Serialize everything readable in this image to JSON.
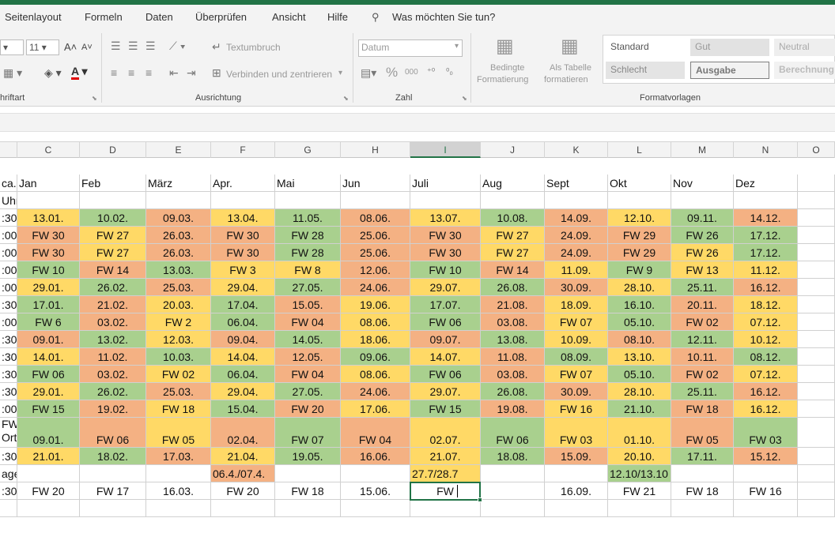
{
  "menu": [
    "Seitenlayout",
    "Formeln",
    "Daten",
    "Überprüfen",
    "Ansicht",
    "Hilfe"
  ],
  "tell_me": "Was möchten Sie tun?",
  "ribbon": {
    "font_size": "11",
    "wrap_text": "Textumbruch",
    "merge_center": "Verbinden und zentrieren",
    "number_format": "Datum",
    "percent": "%",
    "thousands": "000",
    "cond_format_1": "Bedingte",
    "cond_format_2": "Formatierung",
    "as_table_1": "Als Tabelle",
    "as_table_2": "formatieren",
    "groups": {
      "font": "hriftart",
      "alignment": "Ausrichtung",
      "number": "Zahl",
      "styles": "Formatvorlagen"
    },
    "styles": {
      "standard": "Standard",
      "gut": "Gut",
      "neutral": "Neutral",
      "schlecht": "Schlecht",
      "ausgabe": "Ausgabe",
      "berechnung": "Berechnung"
    }
  },
  "colors": {
    "green": "#a9d08e",
    "yellow": "#ffd966",
    "orange": "#f4b183",
    "excel_green": "#217346"
  },
  "col_headers": [
    "C",
    "D",
    "E",
    "F",
    "G",
    "H",
    "I",
    "J",
    "K",
    "L",
    "M",
    "N",
    "O"
  ],
  "selected_column": "I",
  "header_row_a": "ca.",
  "header_row_b": "Uhr",
  "months": [
    "Jan",
    "Feb",
    "März",
    "Apr.",
    "Mai",
    "Jun",
    "Juli",
    "Aug",
    "Sept",
    "Okt",
    "Nov",
    "Dez"
  ],
  "rows": [
    {
      "a": ":30",
      "v": [
        [
          "13.01.",
          "y"
        ],
        [
          "10.02.",
          "g"
        ],
        [
          "09.03.",
          "o"
        ],
        [
          "13.04.",
          "y"
        ],
        [
          "11.05.",
          "g"
        ],
        [
          "08.06.",
          "o"
        ],
        [
          "13.07.",
          "y"
        ],
        [
          "10.08.",
          "g"
        ],
        [
          "14.09.",
          "o"
        ],
        [
          "12.10.",
          "y"
        ],
        [
          "09.11.",
          "g"
        ],
        [
          "14.12.",
          "o"
        ]
      ]
    },
    {
      "a": ":00",
      "v": [
        [
          "FW 30",
          "o"
        ],
        [
          "FW 27",
          "y"
        ],
        [
          "26.03.",
          "o"
        ],
        [
          "FW 30",
          "o"
        ],
        [
          "FW 28",
          "g"
        ],
        [
          "25.06.",
          "o"
        ],
        [
          "FW 30",
          "o"
        ],
        [
          "FW 27",
          "y"
        ],
        [
          "24.09.",
          "o"
        ],
        [
          "FW 29",
          "o"
        ],
        [
          "FW 26",
          "g"
        ],
        [
          "17.12.",
          "g"
        ]
      ]
    },
    {
      "a": ":00",
      "v": [
        [
          "FW 30",
          "o"
        ],
        [
          "FW 27",
          "y"
        ],
        [
          "26.03.",
          "o"
        ],
        [
          "FW 30",
          "o"
        ],
        [
          "FW 28",
          "g"
        ],
        [
          "25.06.",
          "o"
        ],
        [
          "FW 30",
          "o"
        ],
        [
          "FW 27",
          "y"
        ],
        [
          "24.09.",
          "o"
        ],
        [
          "FW 29",
          "o"
        ],
        [
          "FW 26",
          "y"
        ],
        [
          "17.12.",
          "g"
        ]
      ]
    },
    {
      "a": ":00",
      "v": [
        [
          "FW 10",
          "g"
        ],
        [
          "FW 14",
          "o"
        ],
        [
          "13.03.",
          "g"
        ],
        [
          "FW 3",
          "y"
        ],
        [
          "FW 8",
          "y"
        ],
        [
          "12.06.",
          "o"
        ],
        [
          "FW 10",
          "g"
        ],
        [
          "FW 14",
          "o"
        ],
        [
          "11.09.",
          "y"
        ],
        [
          "FW 9",
          "g"
        ],
        [
          "FW 13",
          "y"
        ],
        [
          "11.12.",
          "y"
        ]
      ]
    },
    {
      "a": ":00",
      "v": [
        [
          "29.01.",
          "y"
        ],
        [
          "26.02.",
          "g"
        ],
        [
          "25.03.",
          "o"
        ],
        [
          "29.04.",
          "y"
        ],
        [
          "27.05.",
          "g"
        ],
        [
          "24.06.",
          "o"
        ],
        [
          "29.07.",
          "y"
        ],
        [
          "26.08.",
          "g"
        ],
        [
          "30.09.",
          "o"
        ],
        [
          "28.10.",
          "y"
        ],
        [
          "25.11.",
          "g"
        ],
        [
          "16.12.",
          "o"
        ]
      ]
    },
    {
      "a": ":30",
      "v": [
        [
          "17.01.",
          "g"
        ],
        [
          "21.02.",
          "o"
        ],
        [
          "20.03.",
          "y"
        ],
        [
          "17.04.",
          "g"
        ],
        [
          "15.05.",
          "o"
        ],
        [
          "19.06.",
          "y"
        ],
        [
          "17.07.",
          "g"
        ],
        [
          "21.08.",
          "o"
        ],
        [
          "18.09.",
          "y"
        ],
        [
          "16.10.",
          "g"
        ],
        [
          "20.11.",
          "o"
        ],
        [
          "18.12.",
          "y"
        ]
      ]
    },
    {
      "a": ":00",
      "v": [
        [
          "FW 6",
          "g"
        ],
        [
          "03.02.",
          "o"
        ],
        [
          "FW 2",
          "y"
        ],
        [
          "06.04.",
          "g"
        ],
        [
          "FW 04",
          "o"
        ],
        [
          "08.06.",
          "y"
        ],
        [
          "FW 06",
          "g"
        ],
        [
          "03.08.",
          "o"
        ],
        [
          "FW 07",
          "y"
        ],
        [
          "05.10.",
          "g"
        ],
        [
          "FW 02",
          "o"
        ],
        [
          "07.12.",
          "y"
        ]
      ]
    },
    {
      "a": ":30",
      "v": [
        [
          "09.01.",
          "o"
        ],
        [
          "13.02.",
          "g"
        ],
        [
          "12.03.",
          "y"
        ],
        [
          "09.04.",
          "o"
        ],
        [
          "14.05.",
          "g"
        ],
        [
          "18.06.",
          "y"
        ],
        [
          "09.07.",
          "o"
        ],
        [
          "13.08.",
          "g"
        ],
        [
          "10.09.",
          "y"
        ],
        [
          "08.10.",
          "o"
        ],
        [
          "12.11.",
          "g"
        ],
        [
          "10.12.",
          "y"
        ]
      ]
    },
    {
      "a": ":30",
      "v": [
        [
          "14.01.",
          "y"
        ],
        [
          "11.02.",
          "o"
        ],
        [
          "10.03.",
          "g"
        ],
        [
          "14.04.",
          "y"
        ],
        [
          "12.05.",
          "o"
        ],
        [
          "09.06.",
          "g"
        ],
        [
          "14.07.",
          "y"
        ],
        [
          "11.08.",
          "o"
        ],
        [
          "08.09.",
          "g"
        ],
        [
          "13.10.",
          "y"
        ],
        [
          "10.11.",
          "o"
        ],
        [
          "08.12.",
          "g"
        ]
      ]
    },
    {
      "a": ":30",
      "v": [
        [
          "FW 06",
          "g"
        ],
        [
          "03.02.",
          "o"
        ],
        [
          "FW 02",
          "y"
        ],
        [
          "06.04.",
          "g"
        ],
        [
          "FW 04",
          "o"
        ],
        [
          "08.06.",
          "y"
        ],
        [
          "FW 06",
          "g"
        ],
        [
          "03.08.",
          "o"
        ],
        [
          "FW 07",
          "y"
        ],
        [
          "05.10.",
          "g"
        ],
        [
          "FW 02",
          "o"
        ],
        [
          "07.12.",
          "y"
        ]
      ]
    },
    {
      "a": ":30",
      "v": [
        [
          "29.01.",
          "y"
        ],
        [
          "26.02.",
          "g"
        ],
        [
          "25.03.",
          "o"
        ],
        [
          "29.04.",
          "y"
        ],
        [
          "27.05.",
          "g"
        ],
        [
          "24.06.",
          "o"
        ],
        [
          "29.07.",
          "y"
        ],
        [
          "26.08.",
          "g"
        ],
        [
          "30.09.",
          "o"
        ],
        [
          "28.10.",
          "y"
        ],
        [
          "25.11.",
          "g"
        ],
        [
          "16.12.",
          "o"
        ]
      ]
    },
    {
      "a": ":00",
      "v": [
        [
          "FW 15",
          "g"
        ],
        [
          "19.02.",
          "o"
        ],
        [
          "FW 18",
          "y"
        ],
        [
          "15.04.",
          "g"
        ],
        [
          "FW 20",
          "o"
        ],
        [
          "17.06.",
          "y"
        ],
        [
          "FW 15",
          "g"
        ],
        [
          "19.08.",
          "o"
        ],
        [
          "FW 16",
          "y"
        ],
        [
          "21.10.",
          "g"
        ],
        [
          "FW 18",
          "o"
        ],
        [
          "16.12.",
          "y"
        ]
      ]
    },
    {
      "a": "FW",
      "a2": "Ort",
      "v": [
        [
          "09.01.",
          "g"
        ],
        [
          "FW 06",
          "o"
        ],
        [
          "FW 05",
          "y"
        ],
        [
          "02.04.",
          "o"
        ],
        [
          "FW 07",
          "g"
        ],
        [
          "FW 04",
          "o"
        ],
        [
          "02.07.",
          "y"
        ],
        [
          "FW 06",
          "g"
        ],
        [
          "FW 03",
          "y"
        ],
        [
          "01.10.",
          "y"
        ],
        [
          "FW 05",
          "o"
        ],
        [
          "FW 03",
          "g"
        ]
      ]
    },
    {
      "a": ":30",
      "v": [
        [
          "21.01.",
          "y"
        ],
        [
          "18.02.",
          "g"
        ],
        [
          "17.03.",
          "o"
        ],
        [
          "21.04.",
          "y"
        ],
        [
          "19.05.",
          "g"
        ],
        [
          "16.06.",
          "o"
        ],
        [
          "21.07.",
          "y"
        ],
        [
          "18.08.",
          "g"
        ],
        [
          "15.09.",
          "o"
        ],
        [
          "20.10.",
          "y"
        ],
        [
          "17.11.",
          "g"
        ],
        [
          "15.12.",
          "o"
        ]
      ]
    },
    {
      "a": "age",
      "v": [
        [
          "",
          ""
        ],
        [
          "",
          ""
        ],
        [
          "",
          ""
        ],
        [
          "06.4./07.4.",
          "o"
        ],
        [
          "",
          ""
        ],
        [
          "",
          ""
        ],
        [
          "27.7/28.7",
          "y"
        ],
        [
          "",
          ""
        ],
        [
          "",
          ""
        ],
        [
          "12.10/13.10",
          "g"
        ],
        [
          "",
          ""
        ],
        [
          "",
          ""
        ]
      ]
    },
    {
      "a": ":30",
      "v": [
        [
          "FW 20",
          ""
        ],
        [
          "FW 17",
          ""
        ],
        [
          "16.03.",
          ""
        ],
        [
          "FW 20",
          ""
        ],
        [
          "FW 18",
          ""
        ],
        [
          "15.06.",
          ""
        ],
        [
          "FW",
          ""
        ],
        [
          "",
          ""
        ],
        [
          "16.09.",
          ""
        ],
        [
          "FW 21",
          ""
        ],
        [
          "FW 18",
          ""
        ],
        [
          "FW 16",
          ""
        ]
      ]
    }
  ]
}
